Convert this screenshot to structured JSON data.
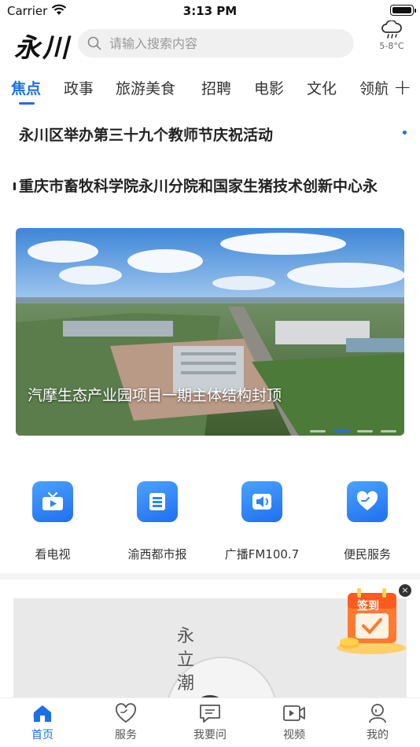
{
  "status_bar": {
    "carrier": "Carrier",
    "time": "3:13 PM"
  },
  "header": {
    "logo_text": "永川",
    "search_placeholder": "请输入搜索内容",
    "weather": {
      "icon": "cloud-rain-icon",
      "temperature": "5-8°C"
    }
  },
  "tabs": {
    "items": [
      "焦点",
      "政事",
      "旅游美食",
      "招聘",
      "电影",
      "文化",
      "领航"
    ],
    "active_index": 0,
    "add_label": "+"
  },
  "headlines": [
    "永川区举办第三十九个教师节庆祝活动",
    "重庆市畜牧科学院永川分院和国家生猪技术创新中心永"
  ],
  "carousel": {
    "caption": "汽摩生态产业园项目一期主体结构封顶",
    "slide_count": 4,
    "active_slide": 1
  },
  "quick_services": [
    {
      "label": "看电视",
      "icon": "tv-icon"
    },
    {
      "label": "渝西都市报",
      "icon": "newspaper-icon"
    },
    {
      "label": "广播FM100.7",
      "icon": "radio-speaker-icon"
    },
    {
      "label": "便民服务",
      "icon": "heart-service-icon"
    }
  ],
  "signin": {
    "label": "签到",
    "close": "×"
  },
  "banner": {
    "art_text": "永立潮"
  },
  "bottom_nav": {
    "items": [
      {
        "label": "首页",
        "icon": "home-icon"
      },
      {
        "label": "服务",
        "icon": "heart-icon"
      },
      {
        "label": "我要问",
        "icon": "chat-icon"
      },
      {
        "label": "视频",
        "icon": "video-icon"
      },
      {
        "label": "我的",
        "icon": "profile-icon"
      }
    ],
    "active_index": 0
  },
  "colors": {
    "accent": "#1d6fe8",
    "text": "#222222",
    "muted": "#999999"
  }
}
